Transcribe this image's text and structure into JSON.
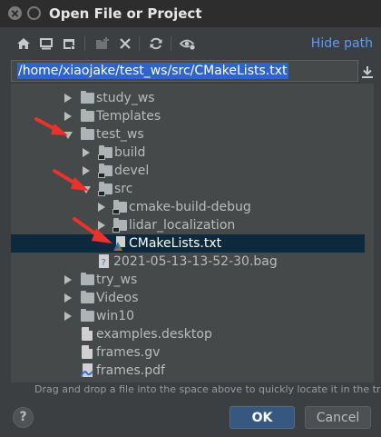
{
  "window": {
    "title": "Open File or Project"
  },
  "toolbar": {
    "icons": [
      "home-icon",
      "desktop-icon",
      "project-icon",
      "new-folder-icon",
      "delete-icon",
      "refresh-icon",
      "show-hidden-icon"
    ],
    "hide_path_label": "Hide path"
  },
  "path": {
    "value": "/home/xiaojake/test_ws/src/CMakeLists.txt"
  },
  "tree": {
    "rows": [
      {
        "label": "study_ws",
        "type": "folder",
        "expanded": false,
        "selected": false
      },
      {
        "label": "Templates",
        "type": "folder",
        "expanded": false,
        "selected": false
      },
      {
        "label": "test_ws",
        "type": "folder",
        "expanded": true,
        "selected": false
      },
      {
        "label": "build",
        "type": "folder",
        "expanded": false,
        "selected": false
      },
      {
        "label": "devel",
        "type": "folder",
        "expanded": false,
        "selected": false
      },
      {
        "label": "src",
        "type": "folder",
        "expanded": true,
        "selected": false
      },
      {
        "label": "cmake-build-debug",
        "type": "folder",
        "expanded": false,
        "selected": false
      },
      {
        "label": "lidar_localization",
        "type": "folder",
        "expanded": false,
        "selected": false
      },
      {
        "label": "CMakeLists.txt",
        "type": "cmake-file",
        "selected": true
      },
      {
        "label": "2021-05-13-13-52-30.bag",
        "type": "file",
        "selected": false
      },
      {
        "label": "try_ws",
        "type": "folder",
        "expanded": false,
        "selected": false
      },
      {
        "label": "Videos",
        "type": "folder",
        "expanded": false,
        "selected": false
      },
      {
        "label": "win10",
        "type": "folder",
        "expanded": false,
        "selected": false
      },
      {
        "label": "examples.desktop",
        "type": "file",
        "selected": false
      },
      {
        "label": "frames.gv",
        "type": "file",
        "selected": false
      },
      {
        "label": "frames.pdf",
        "type": "pdf-file",
        "selected": false
      }
    ]
  },
  "hint": "Drag and drop a file into the space above to quickly locate it in the tree",
  "buttons": {
    "help": "?",
    "ok": "OK",
    "cancel": "Cancel"
  },
  "colors": {
    "accent": "#589df6",
    "selection": "#0d293e",
    "path_highlight": "#2f65ca",
    "annotation_arrow": "#e8322a"
  }
}
